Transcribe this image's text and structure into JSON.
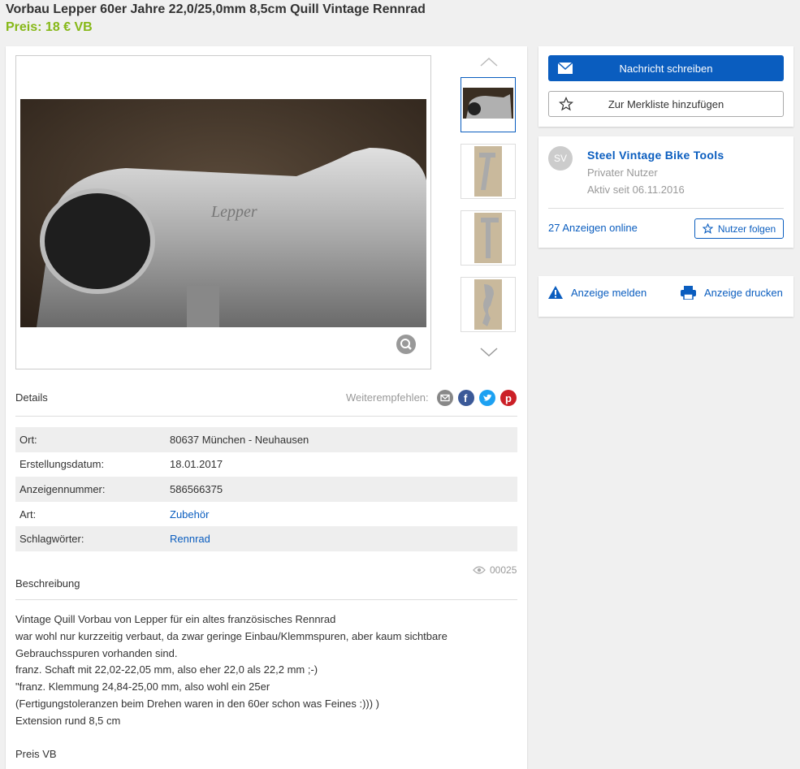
{
  "listing": {
    "title": "Vorbau Lepper 60er Jahre 22,0/25,0mm 8,5cm Quill Vintage Rennrad",
    "price": "Preis: 18 € VB"
  },
  "gallery": {
    "thumbnails": 4
  },
  "details_section": {
    "label": "Details",
    "share_label": "Weiterempfehlen:",
    "share_icons": [
      "mail-icon",
      "facebook-icon",
      "twitter-icon",
      "pinterest-icon"
    ],
    "rows": [
      {
        "key": "Ort:",
        "value": "80637 München - Neuhausen",
        "link": false
      },
      {
        "key": "Erstellungsdatum:",
        "value": "18.01.2017",
        "link": false
      },
      {
        "key": "Anzeigennummer:",
        "value": "586566375",
        "link": false
      },
      {
        "key": "Art:",
        "value": "Zubehör",
        "link": true
      },
      {
        "key": "Schlagwörter:",
        "value": "Rennrad",
        "link": true
      }
    ],
    "views": "00025"
  },
  "description": {
    "label": "Beschreibung",
    "lines": [
      "Vintage Quill Vorbau von Lepper für ein altes französisches Rennrad",
      "war wohl nur kurzzeitig verbaut, da zwar geringe Einbau/Klemmspuren, aber kaum sichtbare",
      "Gebrauchsspuren vorhanden sind.",
      "franz. Schaft mit 22,02-22,05 mm, also eher 22,0 als 22,2 mm ;-)",
      "\"franz. Klemmung 24,84-25,00 mm, also wohl ein 25er",
      "(Fertigungstoleranzen beim Drehen waren in den 60er schon was Feines :))) )",
      "Extension rund 8,5 cm",
      "",
      "Preis VB"
    ]
  },
  "actions": {
    "message_button": "Nachricht schreiben",
    "watchlist_button": "Zur Merkliste hinzufügen"
  },
  "seller": {
    "initials": "SV",
    "name": "Steel Vintage Bike Tools",
    "type": "Privater Nutzer",
    "active_since": "Aktiv seit 06.11.2016",
    "ads_online": "27 Anzeigen online",
    "follow_button": "Nutzer folgen"
  },
  "report": {
    "report_label": "Anzeige melden",
    "print_label": "Anzeige drucken"
  },
  "colors": {
    "accent": "#0a5dbf",
    "price": "#86b817"
  }
}
